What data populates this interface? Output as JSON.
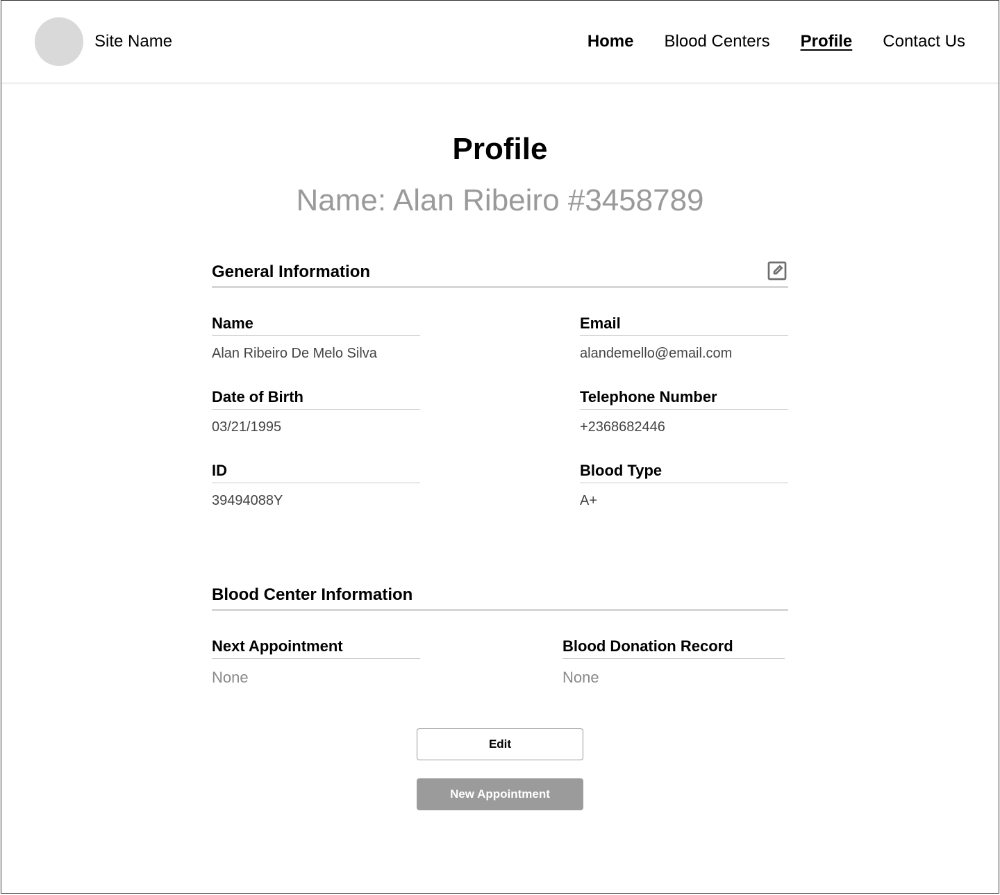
{
  "header": {
    "site_name": "Site Name",
    "nav": {
      "home": "Home",
      "blood_centers": "Blood Centers",
      "profile": "Profile",
      "contact_us": "Contact Us"
    }
  },
  "page": {
    "title": "Profile",
    "subtitle": "Name: Alan Ribeiro #3458789"
  },
  "sections": {
    "general": {
      "title": "General Information",
      "fields": {
        "name": {
          "label": "Name",
          "value": "Alan Ribeiro De Melo Silva"
        },
        "email": {
          "label": "Email",
          "value": "alandemello@email.com"
        },
        "dob": {
          "label": "Date of Birth",
          "value": "03/21/1995"
        },
        "telephone": {
          "label": "Telephone Number",
          "value": "+2368682446"
        },
        "id": {
          "label": "ID",
          "value": "39494088Y"
        },
        "blood_type": {
          "label": "Blood Type",
          "value": "A+"
        }
      }
    },
    "blood_center": {
      "title": "Blood Center Information",
      "fields": {
        "next_appointment": {
          "label": "Next Appointment",
          "value": "None"
        },
        "donation_record": {
          "label": "Blood Donation Record",
          "value": "None"
        }
      }
    }
  },
  "buttons": {
    "edit": "Edit",
    "new_appointment": "New Appointment"
  }
}
